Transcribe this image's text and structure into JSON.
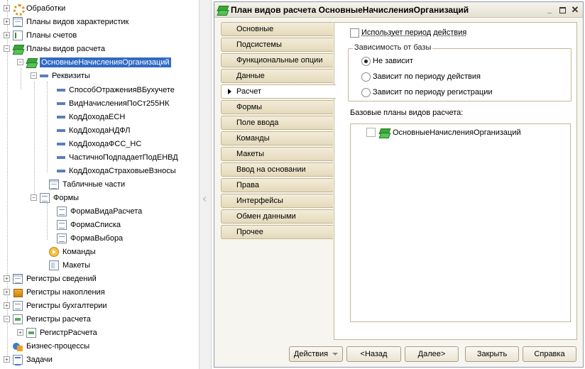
{
  "tree": {
    "items": [
      {
        "label": "Обработки"
      },
      {
        "label": "Планы видов характеристик"
      },
      {
        "label": "Планы счетов"
      },
      {
        "label": "Планы видов расчета"
      },
      {
        "label": "ОсновныеНачисленияОрганизаций"
      },
      {
        "label": "Реквизиты"
      },
      {
        "label": "СпособОтраженияВБухучете"
      },
      {
        "label": "ВидНачисленияПоСт255НК"
      },
      {
        "label": "КодДоходаЕСН"
      },
      {
        "label": "КодДоходаНДФЛ"
      },
      {
        "label": "КодДоходаФСС_НС"
      },
      {
        "label": "ЧастичноПодпадаетПодЕНВД"
      },
      {
        "label": "КодДоходаСтраховыеВзносы"
      },
      {
        "label": "Табличные части"
      },
      {
        "label": "Формы"
      },
      {
        "label": "ФормаВидаРасчета"
      },
      {
        "label": "ФормаСписка"
      },
      {
        "label": "ФормаВыбора"
      },
      {
        "label": "Команды"
      },
      {
        "label": "Макеты"
      },
      {
        "label": "Регистры сведений"
      },
      {
        "label": "Регистры накопления"
      },
      {
        "label": "Регистры бухгалтерии"
      },
      {
        "label": "Регистры расчета"
      },
      {
        "label": "РегистрРасчета"
      },
      {
        "label": "Бизнес-процессы"
      },
      {
        "label": "Задачи"
      }
    ]
  },
  "window": {
    "title": "План видов расчета ОсновныеНачисленияОрганизаций",
    "tabs": [
      {
        "label": "Основные"
      },
      {
        "label": "Подсистемы"
      },
      {
        "label": "Функциональные опции"
      },
      {
        "label": "Данные"
      },
      {
        "label": "Расчет"
      },
      {
        "label": "Формы"
      },
      {
        "label": "Поле ввода"
      },
      {
        "label": "Команды"
      },
      {
        "label": "Макеты"
      },
      {
        "label": "Ввод на основании"
      },
      {
        "label": "Права"
      },
      {
        "label": "Интерфейсы"
      },
      {
        "label": "Обмен данными"
      },
      {
        "label": "Прочее"
      }
    ],
    "active_tab": "Расчет",
    "uses_period_label": "Использует период действия",
    "base_dependency": {
      "title": "Зависимость от базы",
      "options": [
        "Не зависит",
        "Зависит по периоду действия",
        "Зависит по периоду регистрации"
      ],
      "selected": "Не зависит"
    },
    "base_plans_label": "Базовые планы видов расчета:",
    "base_plans": [
      {
        "label": "ОсновныеНачисленияОрганизаций",
        "checked": false
      }
    ],
    "buttons": {
      "actions": "Действия",
      "back": "<Назад",
      "next": "Далее>",
      "close": "Закрыть",
      "help": "Справка"
    }
  }
}
